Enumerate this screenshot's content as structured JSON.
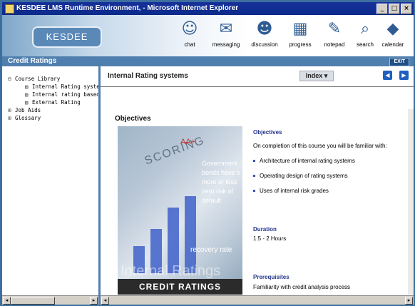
{
  "window": {
    "title": "KESDEE LMS Runtime Environment, - Microsoft Internet Explorer",
    "controls": [
      "_",
      "□",
      "×"
    ]
  },
  "header": {
    "logo_text": "KESDEE",
    "nav": [
      {
        "label": "chat",
        "icon": "chat-icon",
        "glyph": "☺"
      },
      {
        "label": "messaging",
        "icon": "messaging-icon",
        "glyph": "✉"
      },
      {
        "label": "discussion",
        "icon": "discussion-icon",
        "glyph": "☻"
      },
      {
        "label": "progress",
        "icon": "progress-icon",
        "glyph": "▦"
      },
      {
        "label": "notepad",
        "icon": "notepad-icon",
        "glyph": "✎"
      },
      {
        "label": "search",
        "icon": "search-icon",
        "glyph": "⌕"
      },
      {
        "label": "calendar",
        "icon": "calendar-icon",
        "glyph": "◆"
      }
    ]
  },
  "section_bar": {
    "label": "Credit Ratings",
    "exit_label": "EXIT"
  },
  "tree": {
    "items": [
      {
        "label": "Course Library",
        "glyph": "⊟"
      },
      {
        "label": "Internal Rating systems",
        "glyph": "▤"
      },
      {
        "label": "Internal rating based",
        "glyph": "▤"
      },
      {
        "label": "External Rating",
        "glyph": "▤"
      },
      {
        "label": "Job Aids",
        "glyph": "⊞"
      },
      {
        "label": "Glossary",
        "glyph": "⊞"
      }
    ]
  },
  "main": {
    "page_title": "Internal Rating systems",
    "index_label": "Index",
    "prev_label": "◀",
    "next_label": "▶",
    "section_title": "Objectives",
    "image": {
      "scoring": "SCORING",
      "aa": "AA+",
      "gov": "Government bonds have s more or less zero risk of default",
      "recovery": "recovery rate",
      "internal": "Internal Ratings",
      "caption": "CREDIT RATINGS"
    },
    "objectives_heading": "Objectives",
    "objectives_intro": "On completion of this course you will be familiar with:",
    "objectives": [
      "Architecture of internal rating systems",
      "Operating design of rating systems",
      "Uses of internal risk grades"
    ],
    "duration_heading": "Duration",
    "duration_value": "1.5 - 2 Hours",
    "prereq_heading": "Prerequisites",
    "prereq_value": "Familiarity with credit analysis process"
  },
  "colors": {
    "title_bar": "#0b2a8a",
    "section_bar": "#4f7fae",
    "heading_blue": "#23348a",
    "nav_button": "#1e5fbf"
  }
}
